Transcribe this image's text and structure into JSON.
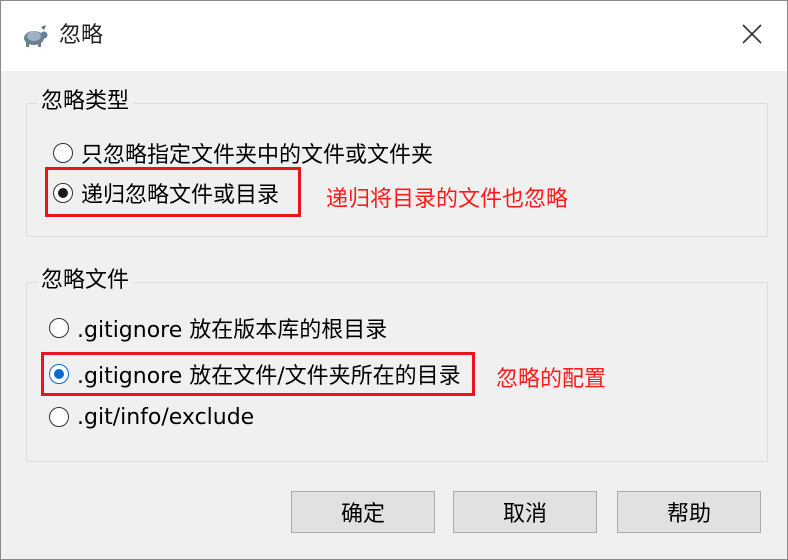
{
  "window": {
    "title": "忽略",
    "icon": "tortoise-icon",
    "close_icon": "close-icon"
  },
  "ignore_type_group": {
    "title": "忽略类型",
    "options": [
      {
        "label": "只忽略指定文件夹中的文件或文件夹",
        "selected": false
      },
      {
        "label": "递归忽略文件或目录",
        "selected": true
      }
    ],
    "annotation": "递归将目录的文件也忽略"
  },
  "ignore_file_group": {
    "title": "忽略文件",
    "options": [
      {
        "label": ".gitignore 放在版本库的根目录",
        "selected": false
      },
      {
        "label": ".gitignore 放在文件/文件夹所在的目录",
        "selected": true
      },
      {
        "label": ".git/info/exclude",
        "selected": false
      }
    ],
    "annotation": "忽略的配置"
  },
  "buttons": {
    "ok": "确定",
    "cancel": "取消",
    "help": "帮助"
  },
  "colors": {
    "annotation_red": "#e8151b",
    "selected_blue": "#0a6ad0"
  }
}
